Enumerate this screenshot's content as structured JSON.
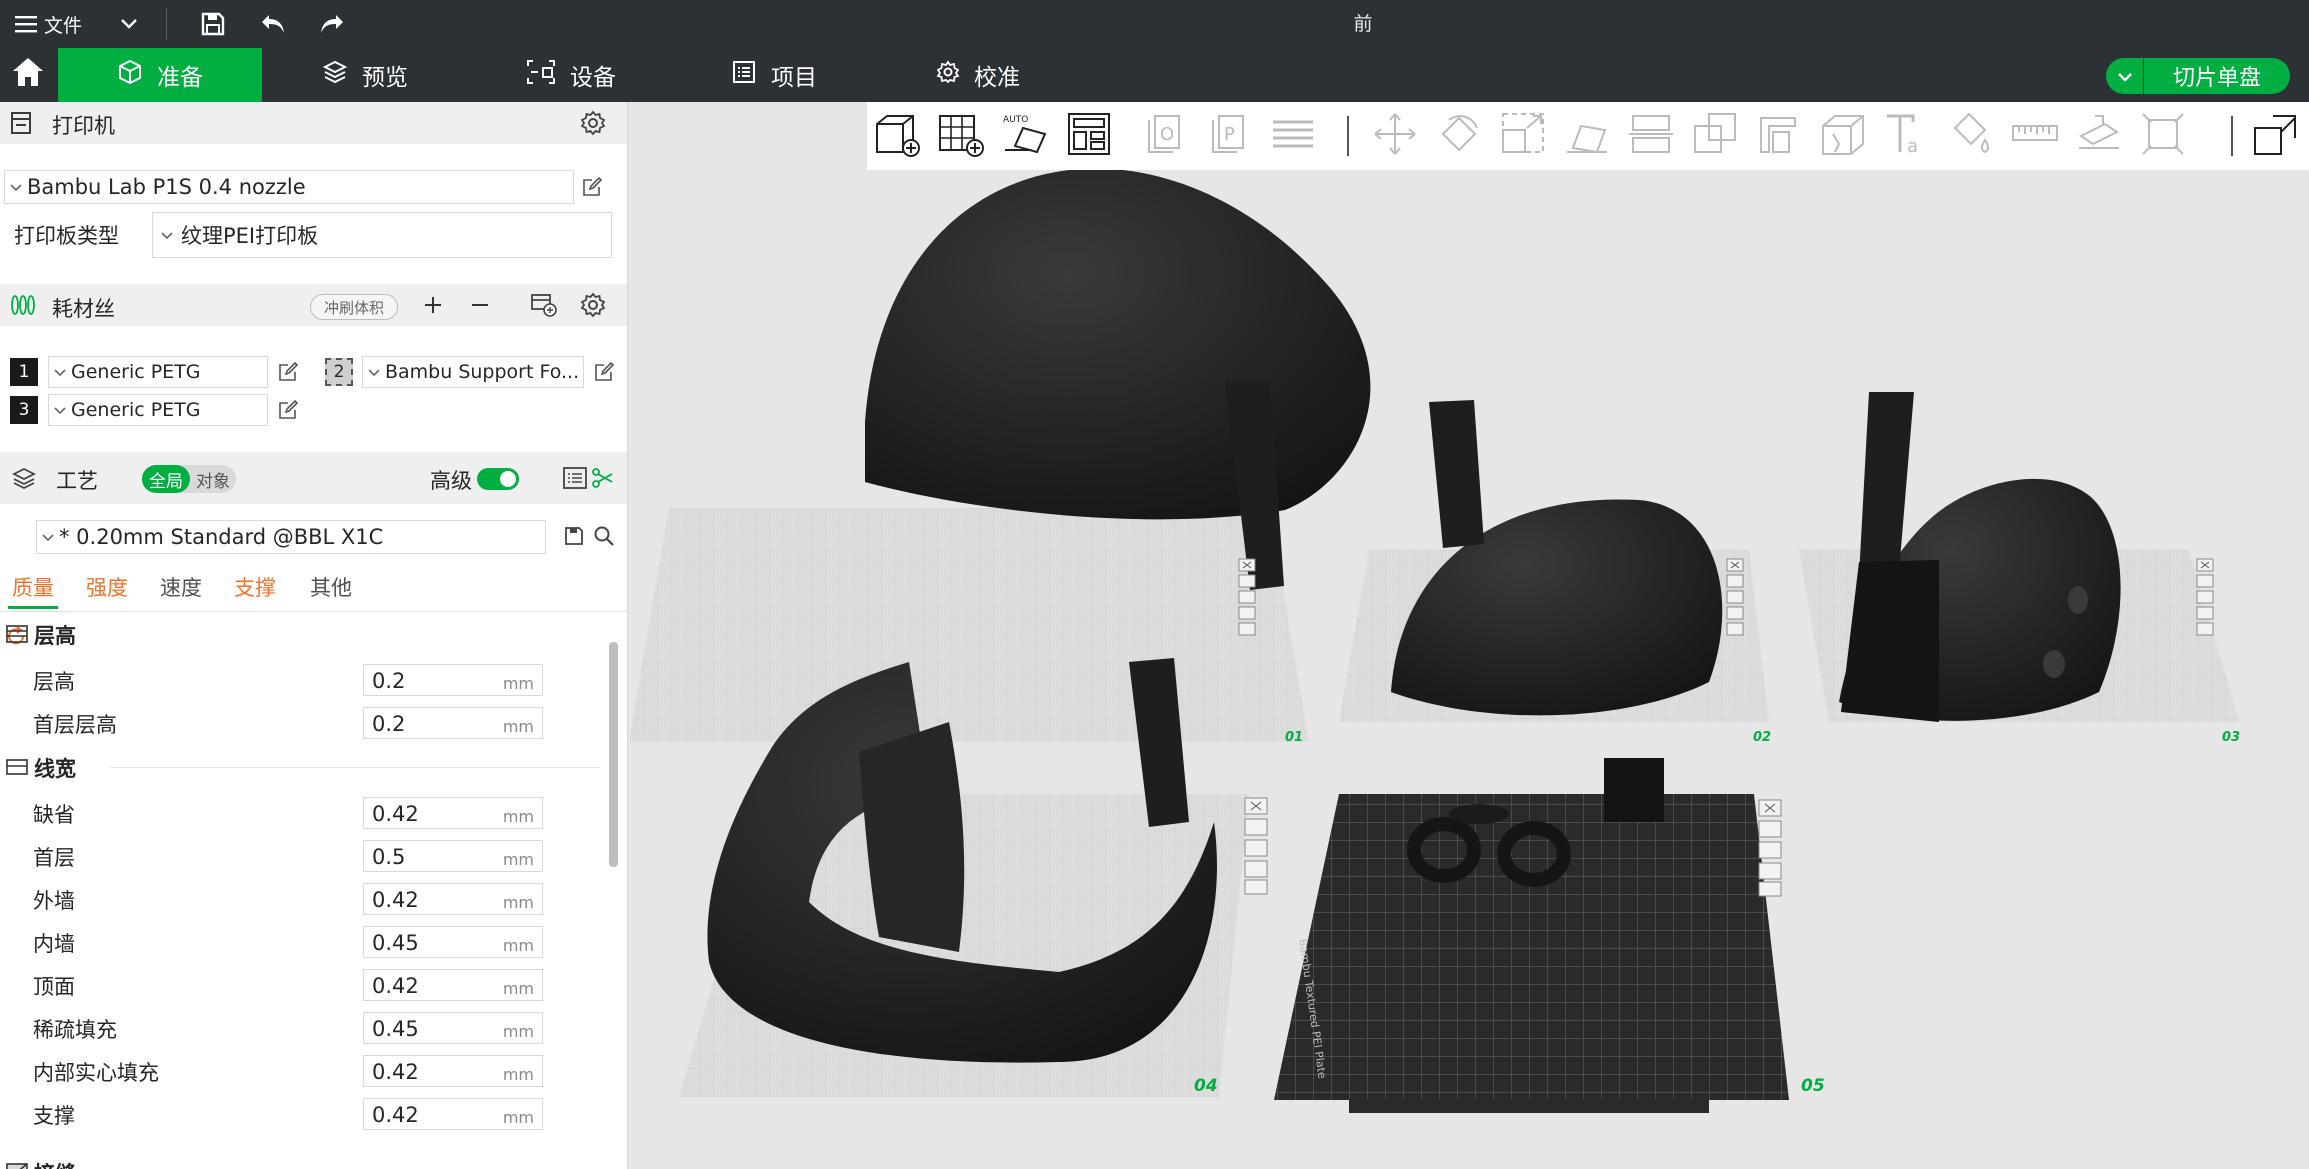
{
  "titlebar": {
    "menu_label": "文件",
    "window_title": "前"
  },
  "nav": {
    "tabs": [
      {
        "label": "准备",
        "icon": "cube-icon",
        "active": true
      },
      {
        "label": "预览",
        "icon": "layers-icon",
        "active": false
      },
      {
        "label": "设备",
        "icon": "device-icon",
        "active": false
      },
      {
        "label": "项目",
        "icon": "project-list-icon",
        "active": false
      },
      {
        "label": "校准",
        "icon": "calibration-gear-icon",
        "active": false
      }
    ],
    "slice_button": "切片单盘"
  },
  "printer": {
    "section_title": "打印机",
    "printer_name": "Bambu Lab P1S 0.4 nozzle",
    "plate_type_label": "打印板类型",
    "plate_type_value": "纹理PEI打印板"
  },
  "filament": {
    "section_title": "耗材丝",
    "flush_volume_button": "冲刷体积",
    "slots": [
      {
        "index": "1",
        "name": "Generic PETG"
      },
      {
        "index": "2",
        "name": "Bambu Support Fo..."
      },
      {
        "index": "3",
        "name": "Generic PETG"
      }
    ]
  },
  "process": {
    "section_title": "工艺",
    "scope_global": "全局",
    "scope_object": "对象",
    "advanced_label": "高级",
    "advanced_on": true,
    "preset_name": "* 0.20mm Standard @BBL X1C",
    "tabs": [
      {
        "label": "质量",
        "active": true
      },
      {
        "label": "强度",
        "active": false
      },
      {
        "label": "速度",
        "active": false
      },
      {
        "label": "支撑",
        "active": false
      },
      {
        "label": "其他",
        "active": false
      }
    ],
    "groups": [
      {
        "title": "层高",
        "options": [
          {
            "label": "层高",
            "value": "0.2",
            "unit": "mm"
          },
          {
            "label": "首层层高",
            "value": "0.2",
            "unit": "mm"
          }
        ]
      },
      {
        "title": "线宽",
        "options": [
          {
            "label": "缺省",
            "value": "0.42",
            "unit": "mm"
          },
          {
            "label": "首层",
            "value": "0.5",
            "unit": "mm"
          },
          {
            "label": "外墙",
            "value": "0.42",
            "unit": "mm"
          },
          {
            "label": "内墙",
            "value": "0.45",
            "unit": "mm"
          },
          {
            "label": "顶面",
            "value": "0.42",
            "unit": "mm"
          },
          {
            "label": "稀疏填充",
            "value": "0.45",
            "unit": "mm"
          },
          {
            "label": "内部实心填充",
            "value": "0.42",
            "unit": "mm"
          },
          {
            "label": "支撑",
            "value": "0.42",
            "unit": "mm"
          }
        ]
      },
      {
        "title": "接缝",
        "options": []
      }
    ]
  },
  "plates": [
    {
      "label": "01"
    },
    {
      "label": "02"
    },
    {
      "label": "03"
    },
    {
      "label": "04"
    },
    {
      "label": "05"
    }
  ],
  "plate5_texts": {
    "brand_text": "Bambu Textured PEI Plate"
  },
  "colors": {
    "accent": "#00ae42",
    "dark_bar": "#2c3136",
    "orange": "#f0722a",
    "model": "#1c1c1c"
  }
}
